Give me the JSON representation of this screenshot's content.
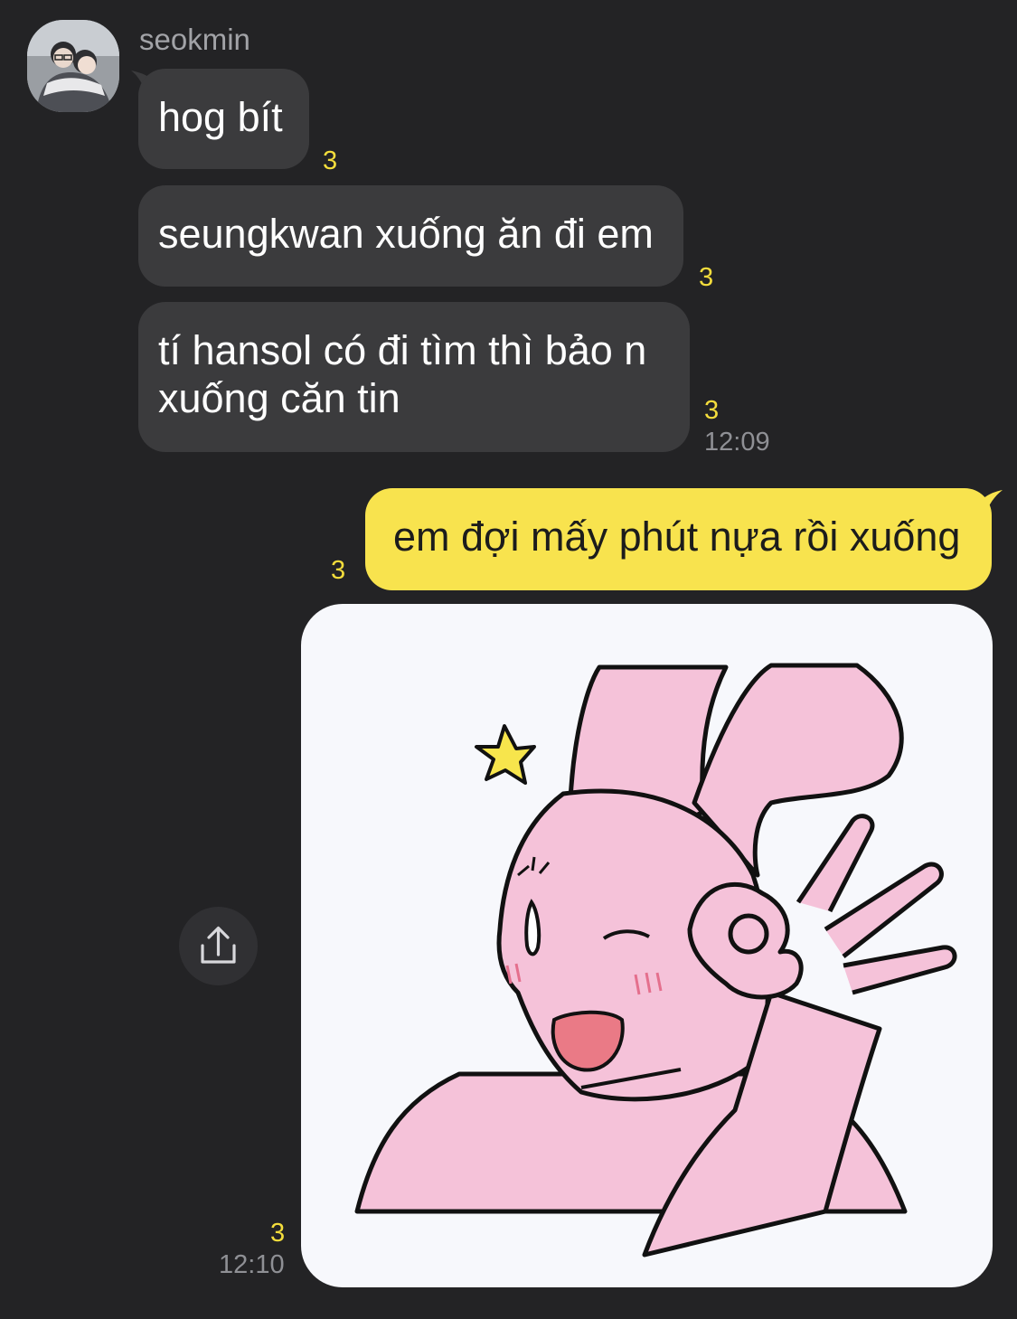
{
  "chat": {
    "sender": {
      "name": "seokmin"
    },
    "messages": [
      {
        "text": "hog bít",
        "unread": "3"
      },
      {
        "text": "seungkwan xuống ăn đi em",
        "unread": "3"
      },
      {
        "line1": "tí hansol có đi tìm thì bảo n",
        "line2": "xuống căn tin",
        "unread": "3",
        "time": "12:09"
      },
      {
        "text": "em đợi mấy phút nựa rồi xuống",
        "unread": "3"
      },
      {
        "sticker": "pink-bunny-ok-sticker",
        "unread": "3",
        "time": "12:10"
      }
    ],
    "share_icon": "share-icon"
  },
  "colors": {
    "background": "#232325",
    "incoming_bubble": "#3b3b3d",
    "outgoing_bubble": "#f8e34e",
    "unread_count": "#f4dd3c",
    "timestamp": "#8f9095",
    "sender_name": "#a2a3a7"
  }
}
